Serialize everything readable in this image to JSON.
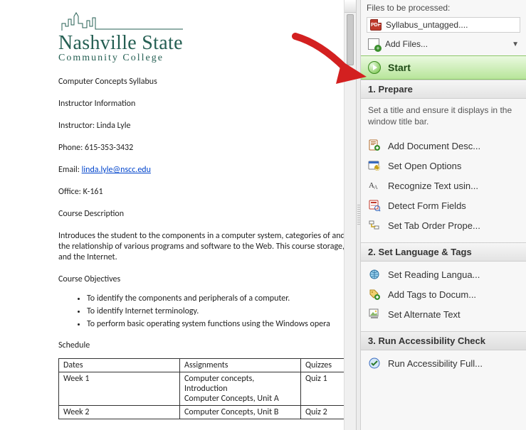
{
  "document": {
    "logo": {
      "line1": "Nashville State",
      "line2": "Community College"
    },
    "heading": "Computer Concepts Syllabus",
    "instructor_heading": "Instructor Information",
    "instructor": "Instructor: Linda Lyle",
    "phone": "Phone: 615-353-3432",
    "email_prefix": "Email: ",
    "email_link": "linda.lyle@nscc.edu",
    "office": "Office: K-161",
    "course_desc_heading": "Course Description",
    "course_desc_body": "Introduces the student to the components in a computer system, categories of and the relationship of various programs and software to the Web. This course storage, and the Internet.",
    "objectives_heading": "Course Objectives",
    "objectives": [
      "To identify the components and peripherals of a computer.",
      "To identify Internet terminology.",
      "To perform basic operating system functions using the Windows opera"
    ],
    "schedule_heading": "Schedule",
    "table": {
      "headers": [
        "Dates",
        "Assignments",
        "Quizzes"
      ],
      "rows": [
        {
          "dates": "Week 1",
          "assign": "Computer concepts, Introduction\nComputer Concepts, Unit A",
          "quiz": "Quiz 1"
        },
        {
          "dates": "Week 2",
          "assign": "Computer Concepts, Unit B",
          "quiz": "Quiz 2"
        }
      ]
    }
  },
  "sidebar": {
    "files_label": "Files to be processed:",
    "file_name": "Syllabus_untagged....",
    "add_files": "Add Files...",
    "start": "Start",
    "sections": [
      {
        "title": "1. Prepare",
        "desc": "Set a title and ensure it displays in the window title bar.",
        "items": [
          {
            "icon": "doc-desc",
            "label": "Add Document Desc..."
          },
          {
            "icon": "open-options",
            "label": "Set Open Options"
          },
          {
            "icon": "recognize-text",
            "label": "Recognize Text usin..."
          },
          {
            "icon": "detect-forms",
            "label": "Detect Form Fields"
          },
          {
            "icon": "tab-order",
            "label": "Set Tab Order Prope..."
          }
        ]
      },
      {
        "title": "2. Set Language & Tags",
        "items": [
          {
            "icon": "reading-lang",
            "label": "Set Reading Langua..."
          },
          {
            "icon": "add-tags",
            "label": "Add Tags to Docum..."
          },
          {
            "icon": "alt-text",
            "label": "Set Alternate Text"
          }
        ]
      },
      {
        "title": "3. Run Accessibility Check",
        "items": [
          {
            "icon": "check",
            "label": "Run Accessibility Full..."
          }
        ]
      }
    ]
  }
}
